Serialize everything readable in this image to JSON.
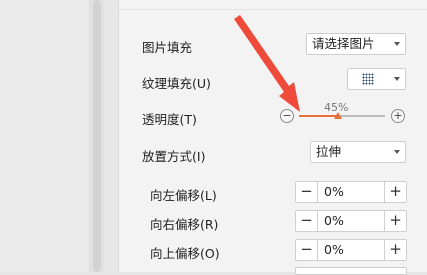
{
  "fill_picture": {
    "label": "图片填充",
    "value": "请选择图片"
  },
  "fill_texture": {
    "label": "纹理填充(U)"
  },
  "transparency": {
    "label": "透明度(T)",
    "value_text": "45%",
    "percent": 45,
    "minus": "−",
    "plus": "+"
  },
  "placement": {
    "label": "放置方式(I)",
    "value": "拉伸"
  },
  "offsets": [
    {
      "label": "向左偏移(L)",
      "value": "0%",
      "minus": "−",
      "plus": "+"
    },
    {
      "label": "向右偏移(R)",
      "value": "0%",
      "minus": "−",
      "plus": "+"
    },
    {
      "label": "向上偏移(O)",
      "value": "0%",
      "minus": "−",
      "plus": "+"
    }
  ],
  "colors": {
    "accent": "#e8703a",
    "annotation_arrow": "#f04a3a"
  }
}
